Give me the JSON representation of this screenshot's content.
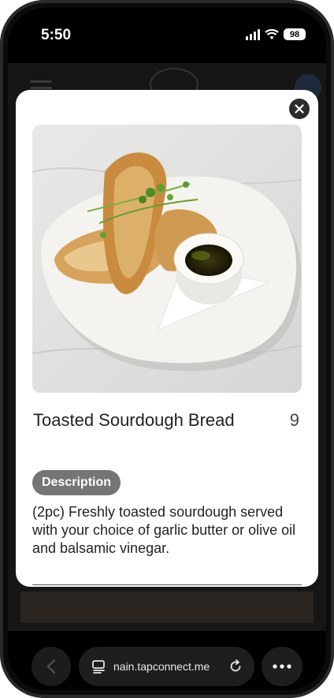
{
  "status_bar": {
    "time": "5:50",
    "battery": "98",
    "icons": [
      "signal-icon",
      "wifi-icon",
      "battery-icon"
    ]
  },
  "modal": {
    "dish_name": "Toasted Sourdough Bread",
    "price": "9",
    "description_label": "Description",
    "description": "(2pc) Freshly toasted sourdough served with your choice of garlic butter or olive oil and balsamic vinegar.",
    "close_icon": "close-icon",
    "image": "toasted-sourdough-photo"
  },
  "browser_bar": {
    "url": "nain.tapconnect.me",
    "icons": [
      "back-icon",
      "tabs-icon",
      "reload-icon",
      "more-icon"
    ]
  },
  "colors": {
    "badge": "#757575",
    "close_button": "#2b2b2b",
    "modal_bg": "#ffffff",
    "backdrop": "#000000"
  }
}
